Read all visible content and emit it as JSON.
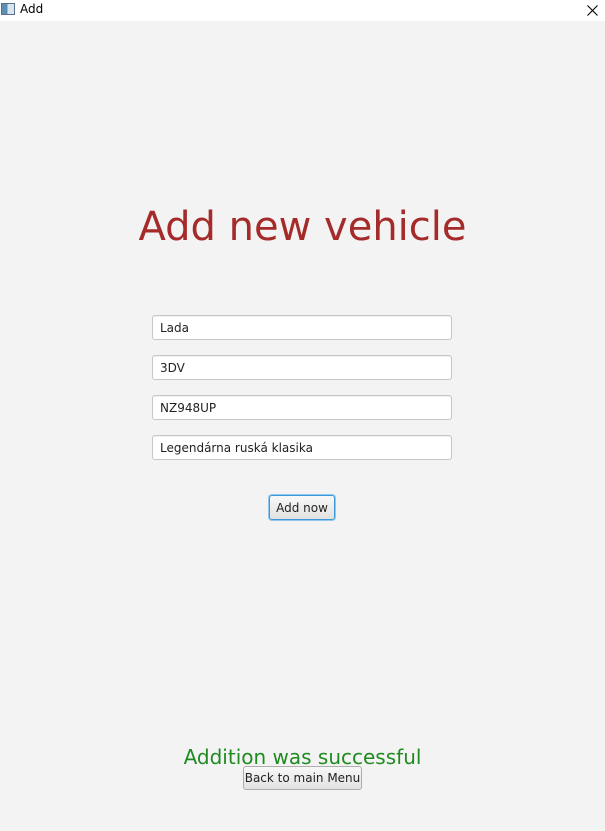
{
  "window": {
    "title": "Add",
    "icon": "app-window-icon",
    "close_icon": "close-icon"
  },
  "heading": "Add new vehicle",
  "form": {
    "fields": [
      {
        "value": "Lada"
      },
      {
        "value": "3DV"
      },
      {
        "value": "NZ948UP"
      },
      {
        "value": "Legendárna ruská klasika"
      }
    ],
    "submit_label": "Add now"
  },
  "status": {
    "message": "Addition was successful",
    "color": "#1f8a1f"
  },
  "back_button_label": "Back to main Menu",
  "colors": {
    "heading": "#a52a2a",
    "background": "#f3f3f3",
    "focus_accent": "#3a9ad9"
  }
}
